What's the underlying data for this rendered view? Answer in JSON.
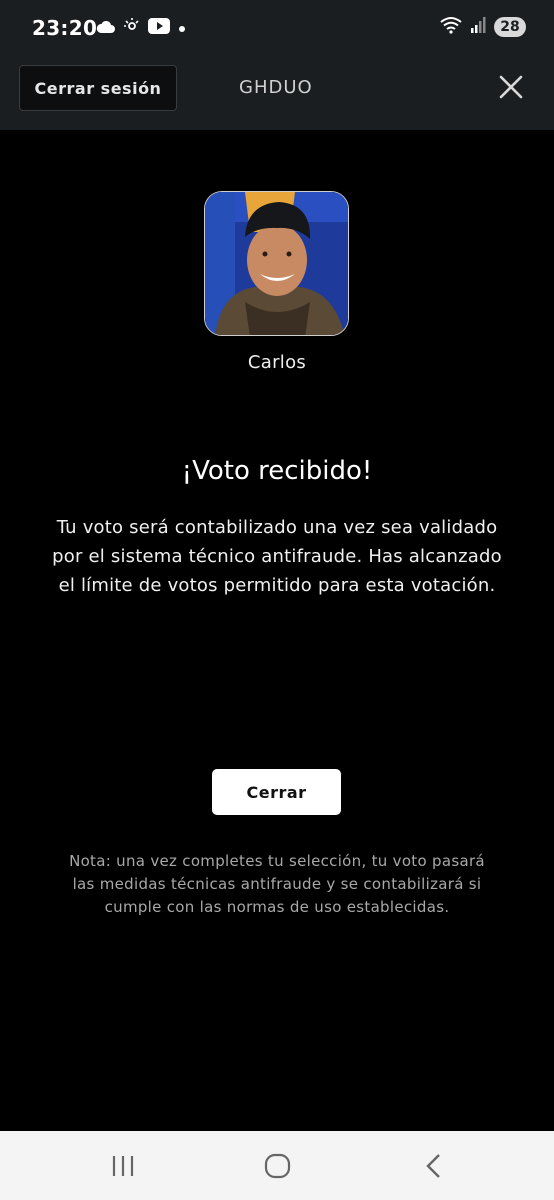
{
  "status_bar": {
    "time": "23:20",
    "battery": "28",
    "icons": [
      "cloud-icon",
      "weather-icon",
      "youtube-icon",
      "dot-icon",
      "wifi-icon",
      "signal-icon"
    ]
  },
  "header": {
    "logout_label": "Cerrar sesión",
    "brand": "GHDUO"
  },
  "candidate": {
    "name": "Carlos"
  },
  "result": {
    "title": "¡Voto recibido!",
    "message": "Tu voto será contabilizado una vez sea validado por el sistema técnico antifraude. Has alcanzado el límite de votos permitido para esta votación."
  },
  "actions": {
    "close_label": "Cerrar"
  },
  "footer": {
    "note": "Nota: una vez completes tu selección, tu voto pasará las medidas técnicas antifraude y se contabilizará si cumple con las normas de uso establecidas."
  },
  "colors": {
    "background": "#000000",
    "header": "#1b1e21",
    "nav_bar": "#f4f4f4"
  }
}
